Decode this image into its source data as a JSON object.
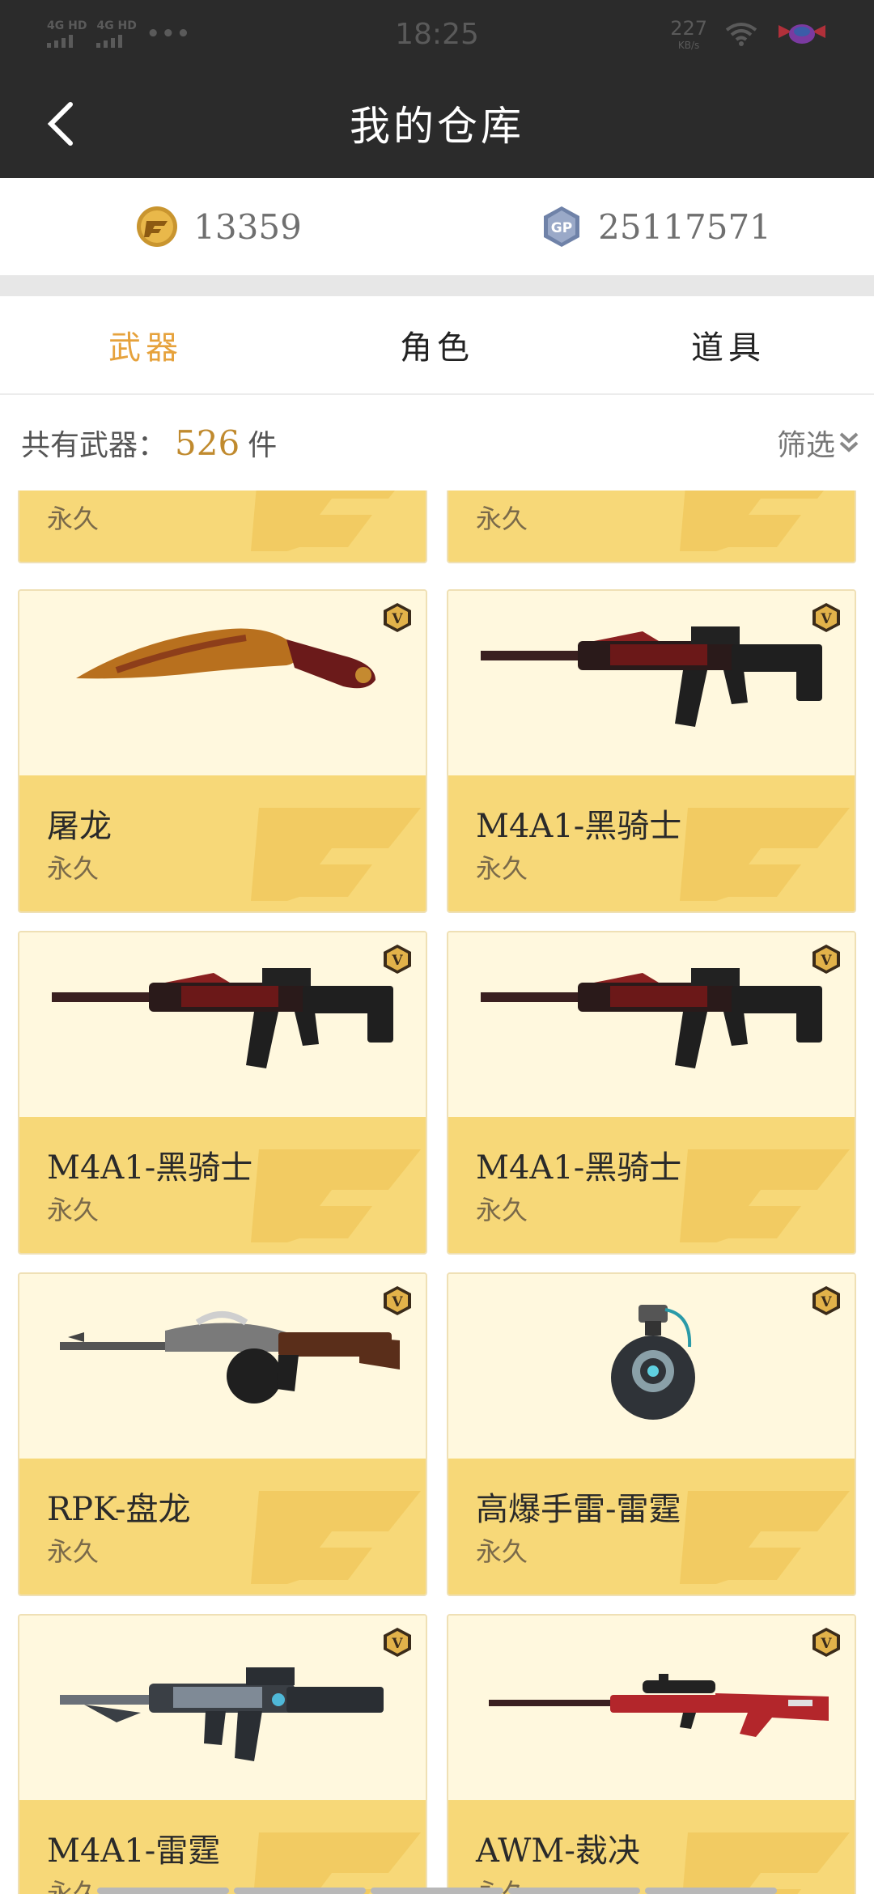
{
  "status_bar": {
    "network_1": "4G HD",
    "network_2": "4G HD",
    "dots": "•••",
    "time": "18:25",
    "speed": "227",
    "speed_unit": "KB/s"
  },
  "header": {
    "title": "我的仓库"
  },
  "currency": {
    "cf_points": "13359",
    "gp_points": "25117571"
  },
  "tabs": [
    {
      "label": "武器",
      "active": true
    },
    {
      "label": "角色",
      "active": false
    },
    {
      "label": "道具",
      "active": false
    }
  ],
  "summary": {
    "prefix": "共有武器：",
    "count": "526",
    "unit": "件",
    "filter_label": "筛选"
  },
  "items": [
    {
      "name": "",
      "duration": "永久",
      "icon": "partial-card"
    },
    {
      "name": "",
      "duration": "永久",
      "icon": "partial-card"
    },
    {
      "name": "屠龙",
      "duration": "永久",
      "icon": "kukri-knife-icon"
    },
    {
      "name": "M4A1-黑骑士",
      "duration": "永久",
      "icon": "assault-rifle-icon"
    },
    {
      "name": "M4A1-黑骑士",
      "duration": "永久",
      "icon": "assault-rifle-icon"
    },
    {
      "name": "M4A1-黑骑士",
      "duration": "永久",
      "icon": "assault-rifle-icon"
    },
    {
      "name": "RPK-盘龙",
      "duration": "永久",
      "icon": "machine-gun-icon"
    },
    {
      "name": "高爆手雷-雷霆",
      "duration": "永久",
      "icon": "grenade-icon"
    },
    {
      "name": "M4A1-雷霆",
      "duration": "永久",
      "icon": "assault-rifle-icon"
    },
    {
      "name": "AWM-裁决",
      "duration": "永久",
      "icon": "sniper-rifle-icon"
    }
  ],
  "colors": {
    "header_bg": "#2b2b2b",
    "active_tab": "#e6a23c",
    "card_bottom": "#f7d878",
    "card_top": "#fff8de"
  }
}
